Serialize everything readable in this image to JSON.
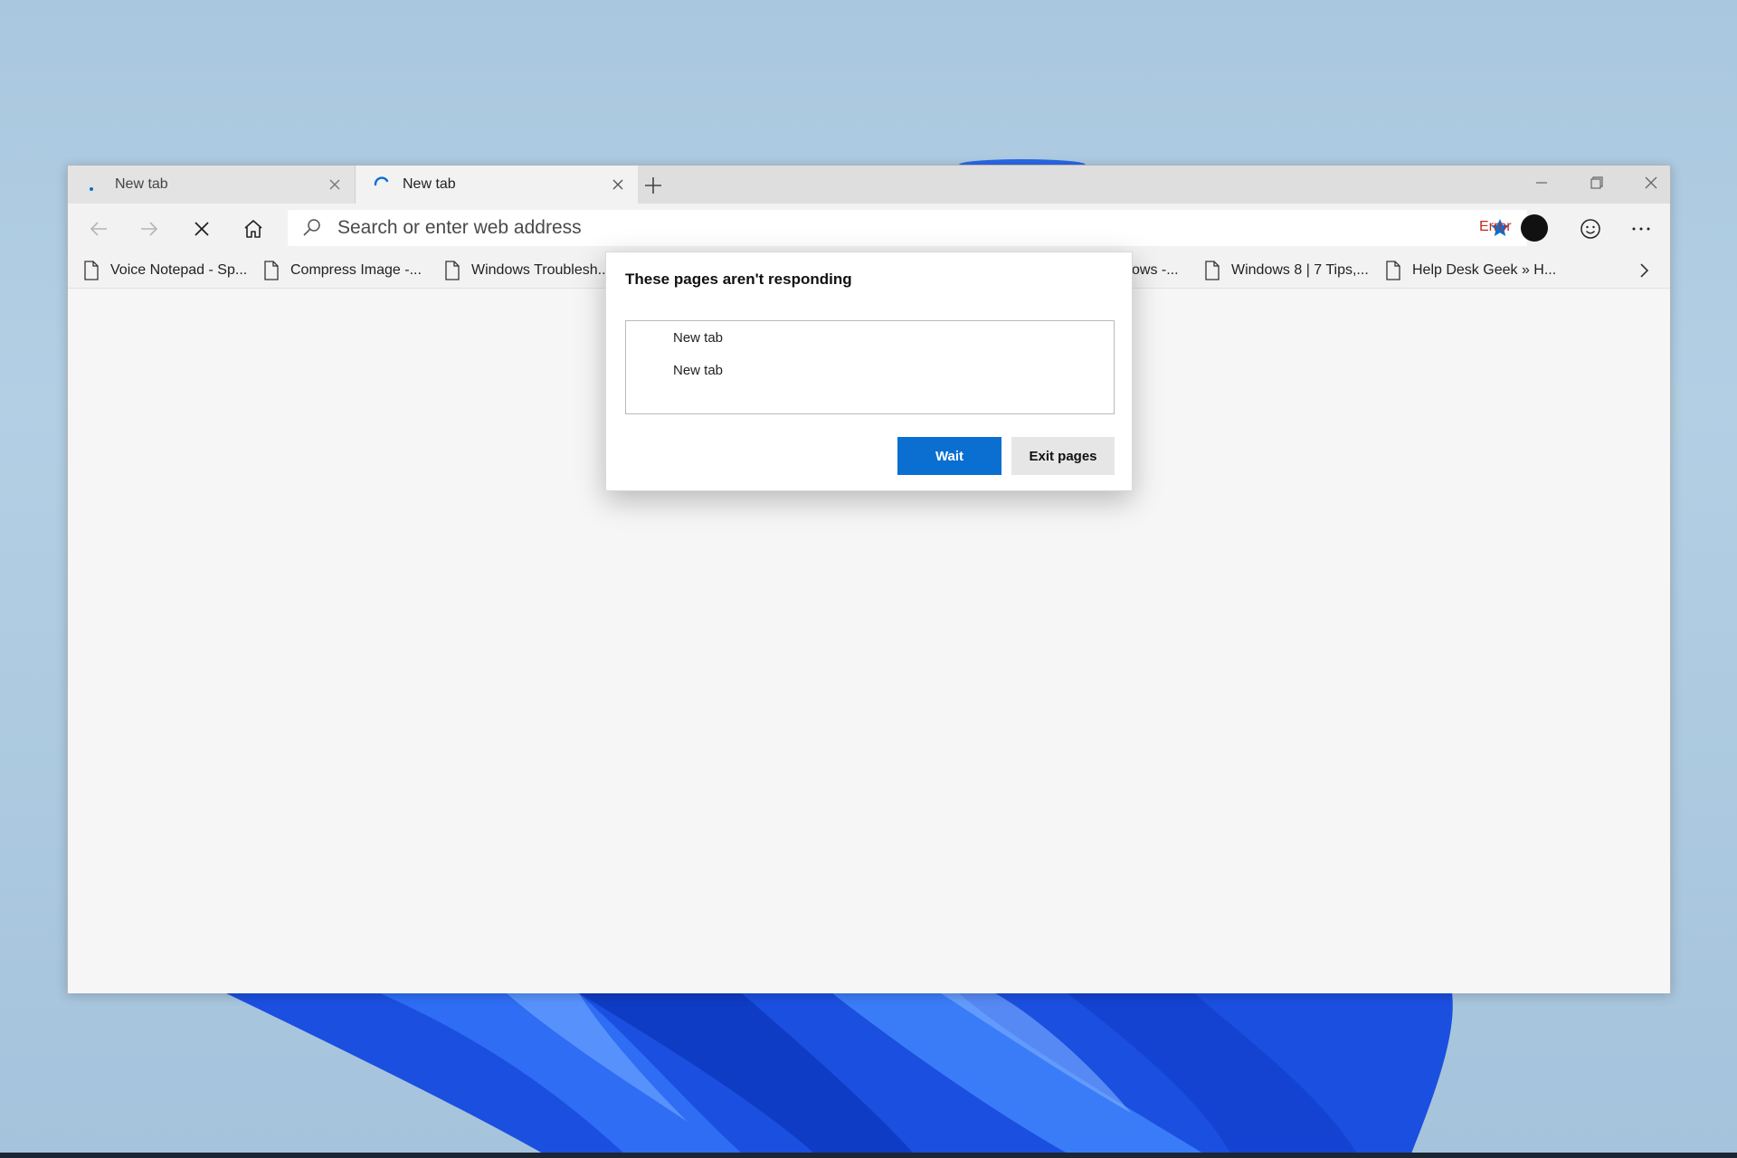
{
  "tabs": [
    {
      "label": "New tab",
      "state": "loading-dot"
    },
    {
      "label": "New tab",
      "state": "loading-spinner"
    }
  ],
  "toolbar": {
    "address_placeholder": "Search or enter web address",
    "profile_status": "Error"
  },
  "favorites": [
    {
      "label": "Voice Notepad - Sp..."
    },
    {
      "label": "Compress Image -..."
    },
    {
      "label": "Windows Troublesh..."
    },
    {
      "label": "ows -..."
    },
    {
      "label": "Windows 8 | 7 Tips,..."
    },
    {
      "label": "Help Desk Geek » H..."
    }
  ],
  "dialog": {
    "title": "These pages aren't responding",
    "pages": [
      "New tab",
      "New tab"
    ],
    "wait_label": "Wait",
    "exit_label": "Exit pages"
  },
  "colors": {
    "accent": "#0a6fd0",
    "error": "#c42b1c",
    "wallpaper_blue": "#1a57e6"
  },
  "icons": [
    "back-arrow-icon",
    "forward-arrow-icon",
    "stop-loading-icon",
    "home-icon",
    "search-icon",
    "star-icon",
    "emoji-icon",
    "more-icon",
    "page-icon",
    "chevron-right-icon"
  ]
}
